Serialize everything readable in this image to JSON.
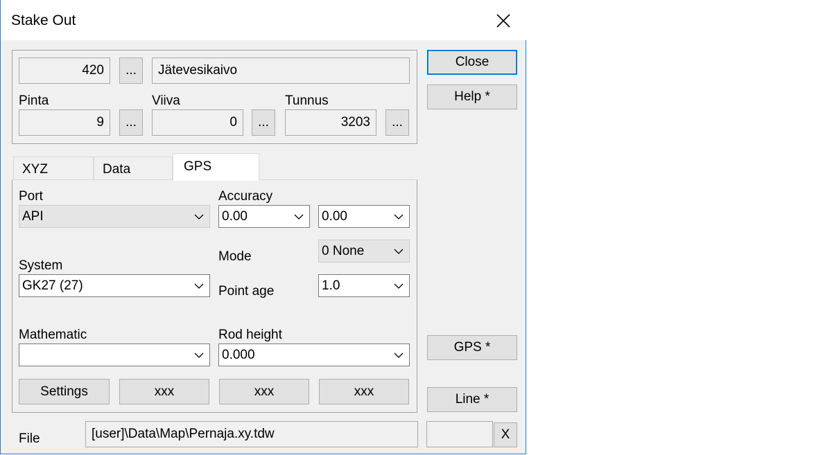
{
  "window": {
    "title": "Stake Out"
  },
  "top_group": {
    "number": "420",
    "name": "Jätevesikaivo",
    "browse_label": "...",
    "pinta": {
      "label": "Pinta",
      "value": "9"
    },
    "viiva": {
      "label": "Viiva",
      "value": "0"
    },
    "tunnus": {
      "label": "Tunnus",
      "value": "3203"
    }
  },
  "tabs": [
    {
      "label": "XYZ"
    },
    {
      "label": "Data"
    },
    {
      "label": "GPS"
    }
  ],
  "gps": {
    "port": {
      "label": "Port",
      "value": "API"
    },
    "accuracy": {
      "label": "Accuracy",
      "value1": "0.00",
      "value2": "0.00"
    },
    "mode": {
      "label": "Mode",
      "value": "0  None"
    },
    "system": {
      "label": "System",
      "value": "GK27  (27)"
    },
    "point_age": {
      "label": "Point age",
      "value": "1.0"
    },
    "mathematic": {
      "label": "Mathematic",
      "value": ""
    },
    "rod_height": {
      "label": "Rod height",
      "value": "0.000"
    },
    "buttons": {
      "settings": "Settings",
      "xxx1": "xxx",
      "xxx2": "xxx",
      "xxx3": "xxx"
    }
  },
  "right_buttons": {
    "close": "Close",
    "help": "Help *",
    "gps": "GPS *",
    "line": "Line *"
  },
  "file": {
    "label": "File",
    "path": "[user]\\Data\\Map\\Pernaja.xy.tdw",
    "aux": "",
    "x_label": "X"
  }
}
